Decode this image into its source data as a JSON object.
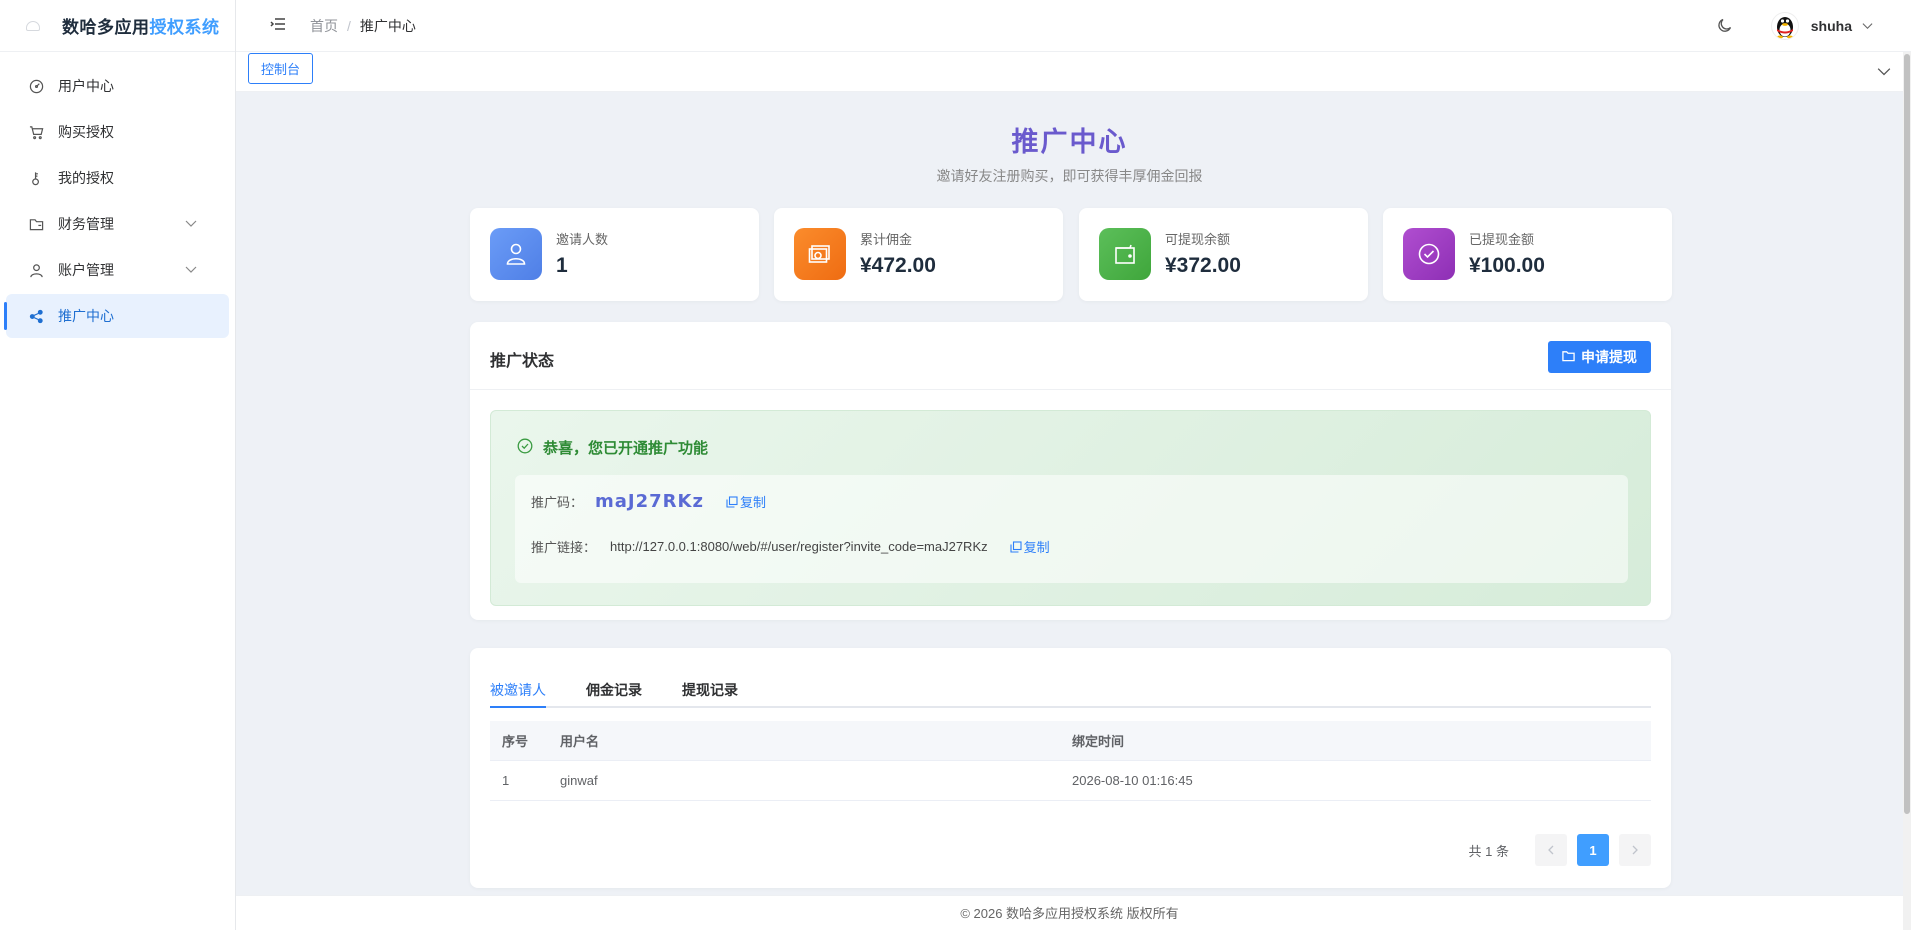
{
  "brand": {
    "title_prefix": "数哈多应用",
    "title_highlight": "授权系统"
  },
  "sidebar": {
    "items": [
      {
        "label": "用户中心",
        "icon": "dashboard-icon"
      },
      {
        "label": "购买授权",
        "icon": "cart-icon"
      },
      {
        "label": "我的授权",
        "icon": "key-icon"
      },
      {
        "label": "财务管理",
        "icon": "folder-icon",
        "expandable": true
      },
      {
        "label": "账户管理",
        "icon": "user-icon",
        "expandable": true
      },
      {
        "label": "推广中心",
        "icon": "share-icon",
        "active": true
      }
    ]
  },
  "header": {
    "breadcrumb": {
      "home": "首页",
      "separator": "/",
      "current": "推广中心"
    },
    "username": "shuha"
  },
  "tagsbar": {
    "active_tag": "控制台"
  },
  "page": {
    "title": "推广中心",
    "subtitle": "邀请好友注册购买，即可获得丰厚佣金回报"
  },
  "stats": [
    {
      "label": "邀请人数",
      "value": "1",
      "icon": "user-icon",
      "color": "#5b8def"
    },
    {
      "label": "累计佣金",
      "value": "¥472.00",
      "icon": "money-icon",
      "color": "#f57c1f"
    },
    {
      "label": "可提现余额",
      "value": "¥372.00",
      "icon": "wallet-icon",
      "color": "#4caf50"
    },
    {
      "label": "已提现金额",
      "value": "¥100.00",
      "icon": "check-circle-icon",
      "color": "#9c3fc4"
    }
  ],
  "status_panel": {
    "title": "推广状态",
    "withdraw_button": "申请提现",
    "success_text": "恭喜，您已开通推广功能",
    "invite_code_label": "推广码：",
    "invite_code": "maJ27RKz",
    "invite_link_label": "推广链接：",
    "invite_link": "http://127.0.0.1:8080/web/#/user/register?invite_code=maJ27RKz",
    "copy_label": "复制"
  },
  "records": {
    "tabs": [
      "被邀请人",
      "佣金记录",
      "提现记录"
    ],
    "active_tab": 0,
    "columns": [
      "序号",
      "用户名",
      "绑定时间"
    ],
    "rows": [
      [
        "1",
        "ginwaf",
        "2026-08-10 01:16:45"
      ]
    ],
    "pager": {
      "total": "共 1 条",
      "current_page": "1"
    }
  },
  "footer": {
    "text": "© 2026 数哈多应用授权系统 版权所有"
  }
}
